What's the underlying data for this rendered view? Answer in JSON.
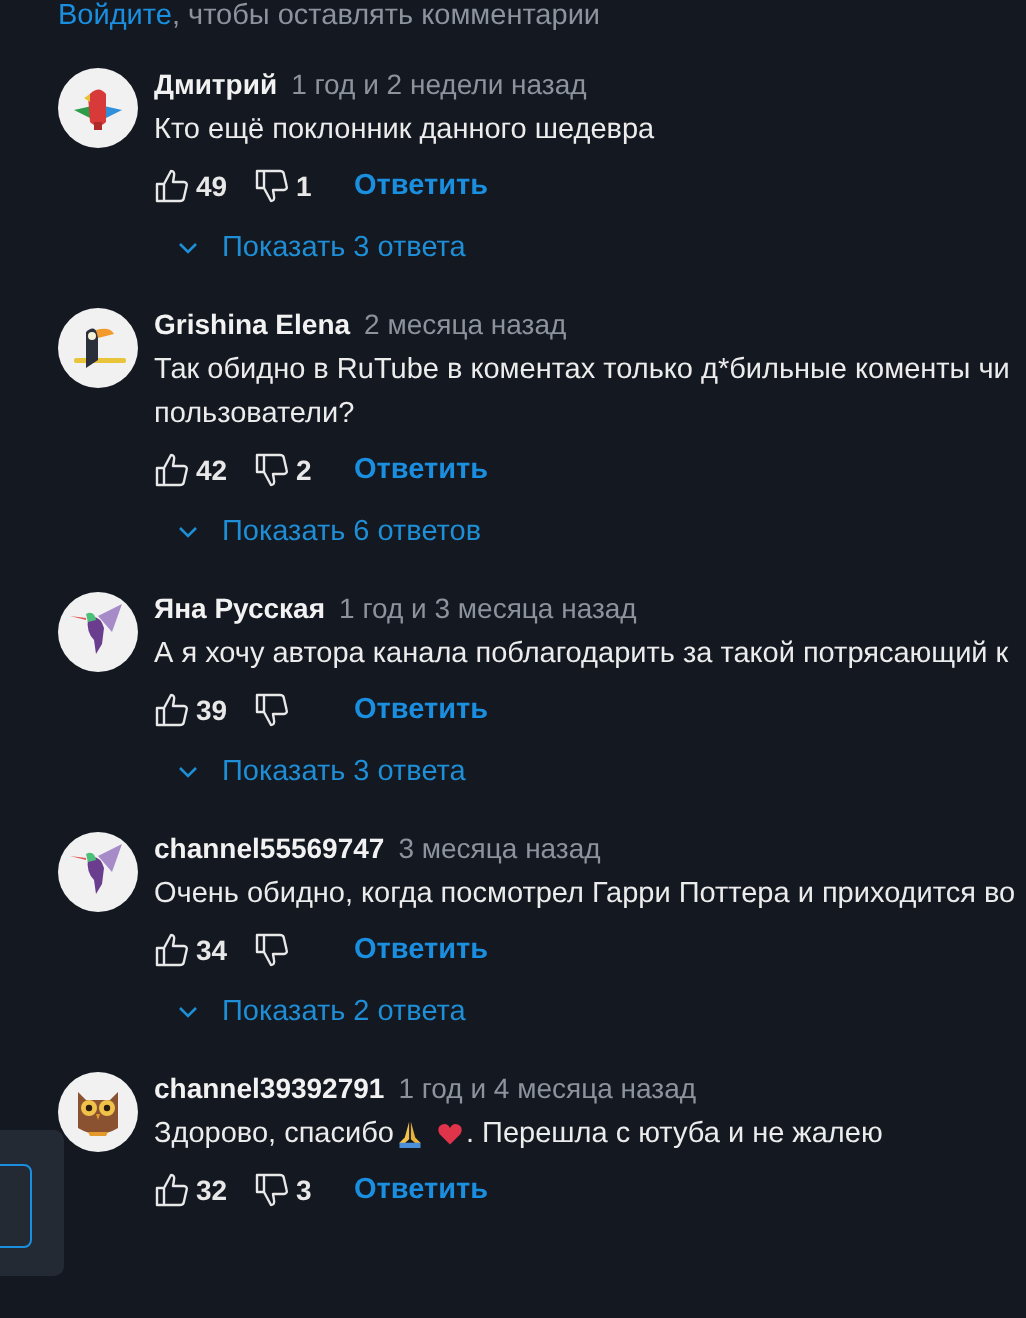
{
  "login_prompt": {
    "link": "Войдите",
    "text": ", чтобы оставлять комментарии"
  },
  "comments": [
    {
      "avatar": {
        "kind": "parrot"
      },
      "author": "Дмитрий",
      "time": "1 год и 2 недели назад",
      "lines": [
        [
          {
            "kind": "text",
            "text": "Кто ещё поклонник данного шедевра"
          }
        ]
      ],
      "likes": "49",
      "dislikes": "1",
      "reply": "Ответить",
      "replies": "Показать 3 ответа"
    },
    {
      "avatar": {
        "kind": "toucan"
      },
      "author": "Grishina Elena",
      "time": "2 месяца назад",
      "lines": [
        [
          {
            "kind": "text",
            "text": "Так обидно в RuTube в коментах только д*бильные коменты чи"
          }
        ],
        [
          {
            "kind": "text",
            "text": "пользователи?"
          }
        ]
      ],
      "likes": "42",
      "dislikes": "2",
      "reply": "Ответить",
      "replies": "Показать 6 ответов"
    },
    {
      "avatar": {
        "kind": "hummingbird"
      },
      "author": "Яна Русская",
      "time": "1 год и 3 месяца назад",
      "lines": [
        [
          {
            "kind": "text",
            "text": "А я хочу автора канала поблагодарить за такой потрясающий к"
          }
        ]
      ],
      "likes": "39",
      "reply": "Ответить",
      "replies": "Показать 3 ответа"
    },
    {
      "avatar": {
        "kind": "hummingbird"
      },
      "author": "channel55569747",
      "time": "3 месяца назад",
      "lines": [
        [
          {
            "kind": "text",
            "text": "Очень обидно, когда посмотрел Гарри Поттера и приходится во"
          }
        ]
      ],
      "likes": "34",
      "reply": "Ответить",
      "replies": "Показать 2 ответа"
    },
    {
      "avatar": {
        "kind": "owl"
      },
      "author": "channel39392791",
      "time": "1 год и 4 месяца назад",
      "lines": [
        [
          {
            "kind": "text",
            "text": "Здорово, спасибо"
          },
          {
            "kind": "hands"
          },
          {
            "kind": "heart"
          },
          {
            "kind": "text",
            "text": ". Перешла с ютуба и не жалею"
          }
        ]
      ],
      "likes": "32",
      "dislikes": "3",
      "reply": "Ответить"
    }
  ]
}
